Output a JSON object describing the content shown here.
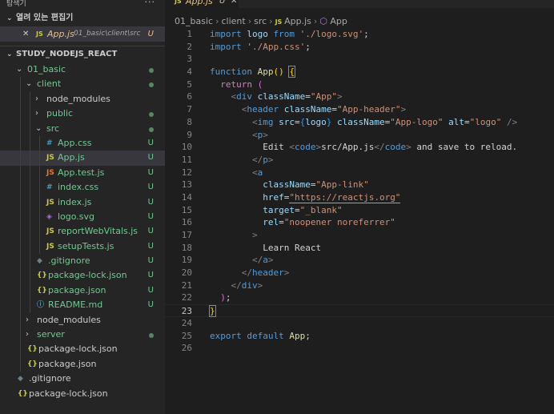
{
  "explorer": {
    "title": "탐색기",
    "more": "···",
    "open_editors_label": "열려 있는 편집기",
    "open_editor": {
      "icon": "JS",
      "name": "App.js",
      "path": "01_basic\\client\\src",
      "status": "U",
      "close": "✕"
    },
    "project_label": "STUDY_NODEJS_REACT"
  },
  "tree": [
    {
      "label": "01_basic",
      "type": "folder",
      "open": true,
      "depth": 0,
      "status": "dot"
    },
    {
      "label": "client",
      "type": "folder",
      "open": true,
      "depth": 1,
      "status": "dot"
    },
    {
      "label": "node_modules",
      "type": "folder",
      "open": false,
      "depth": 2,
      "status": ""
    },
    {
      "label": "public",
      "type": "folder",
      "open": false,
      "depth": 2,
      "status": "dot"
    },
    {
      "label": "src",
      "type": "folder",
      "open": true,
      "depth": 2,
      "status": "dot"
    },
    {
      "label": "App.css",
      "icon": "#",
      "icon_class": "ic-css",
      "depth": 3,
      "status": "U"
    },
    {
      "label": "App.js",
      "icon": "JS",
      "icon_class": "ic-js",
      "depth": 3,
      "status": "U",
      "selected": true
    },
    {
      "label": "App.test.js",
      "icon": "JS",
      "icon_class": "ic-jsx",
      "depth": 3,
      "status": "U"
    },
    {
      "label": "index.css",
      "icon": "#",
      "icon_class": "ic-css",
      "depth": 3,
      "status": "U"
    },
    {
      "label": "index.js",
      "icon": "JS",
      "icon_class": "ic-js",
      "depth": 3,
      "status": "U"
    },
    {
      "label": "logo.svg",
      "icon": "◈",
      "icon_class": "ic-svg",
      "depth": 3,
      "status": "U"
    },
    {
      "label": "reportWebVitals.js",
      "icon": "JS",
      "icon_class": "ic-js",
      "depth": 3,
      "status": "U"
    },
    {
      "label": "setupTests.js",
      "icon": "JS",
      "icon_class": "ic-js",
      "depth": 3,
      "status": "U"
    },
    {
      "label": ".gitignore",
      "icon": "◆",
      "icon_class": "ic-git",
      "depth": 2,
      "status": "U"
    },
    {
      "label": "package-lock.json",
      "icon": "{}",
      "icon_class": "ic-json",
      "depth": 2,
      "status": "U"
    },
    {
      "label": "package.json",
      "icon": "{}",
      "icon_class": "ic-json",
      "depth": 2,
      "status": "U"
    },
    {
      "label": "README.md",
      "icon": "ⓘ",
      "icon_class": "ic-md",
      "depth": 2,
      "status": "U"
    },
    {
      "label": "node_modules",
      "type": "folder",
      "open": false,
      "depth": 1,
      "status": ""
    },
    {
      "label": "server",
      "type": "folder",
      "open": false,
      "depth": 1,
      "status": "dot"
    },
    {
      "label": "package-lock.json",
      "icon": "{}",
      "icon_class": "ic-json",
      "depth": 1,
      "status": "",
      "plain": true
    },
    {
      "label": "package.json",
      "icon": "{}",
      "icon_class": "ic-json",
      "depth": 1,
      "status": "",
      "plain": true
    },
    {
      "label": ".gitignore",
      "icon": "◆",
      "icon_class": "ic-git",
      "depth": 0,
      "status": "",
      "plain": true
    },
    {
      "label": "package-lock.json",
      "icon": "{}",
      "icon_class": "ic-json",
      "depth": 0,
      "status": "",
      "plain": true
    }
  ],
  "tab": {
    "icon": "JS",
    "name": "App.js",
    "status": "U",
    "close": "✕"
  },
  "breadcrumb": [
    "01_basic",
    "client",
    "src",
    "App.js",
    "App"
  ],
  "current_line": 23,
  "code": [
    [
      [
        "kw",
        "import"
      ],
      [
        "pl",
        " "
      ],
      [
        "var",
        "logo"
      ],
      [
        "pl",
        " "
      ],
      [
        "kw",
        "from"
      ],
      [
        "pl",
        " "
      ],
      [
        "str",
        "'./logo.svg'"
      ],
      [
        "pl",
        ";"
      ]
    ],
    [
      [
        "kw",
        "import"
      ],
      [
        "pl",
        " "
      ],
      [
        "str",
        "'./App.css'"
      ],
      [
        "pl",
        ";"
      ]
    ],
    [],
    [
      [
        "kw",
        "function"
      ],
      [
        "pl",
        " "
      ],
      [
        "fnc",
        "App"
      ],
      [
        "brc1",
        "()"
      ],
      [
        "pl",
        " "
      ],
      [
        "brc1",
        "{"
      ]
    ],
    [
      [
        "pl",
        "  "
      ],
      [
        "ctl",
        "return"
      ],
      [
        "pl",
        " "
      ],
      [
        "brc2",
        "("
      ]
    ],
    [
      [
        "pl",
        "    "
      ],
      [
        "brk",
        "<"
      ],
      [
        "tag",
        "div"
      ],
      [
        "pl",
        " "
      ],
      [
        "att",
        "className"
      ],
      [
        "pl",
        "="
      ],
      [
        "str",
        "\"App\""
      ],
      [
        "brk",
        ">"
      ]
    ],
    [
      [
        "pl",
        "      "
      ],
      [
        "brk",
        "<"
      ],
      [
        "tag",
        "header"
      ],
      [
        "pl",
        " "
      ],
      [
        "att",
        "className"
      ],
      [
        "pl",
        "="
      ],
      [
        "str",
        "\"App-header\""
      ],
      [
        "brk",
        ">"
      ]
    ],
    [
      [
        "pl",
        "        "
      ],
      [
        "brk",
        "<"
      ],
      [
        "tag",
        "img"
      ],
      [
        "pl",
        " "
      ],
      [
        "att",
        "src"
      ],
      [
        "pl",
        "="
      ],
      [
        "brc3",
        "{"
      ],
      [
        "var",
        "logo"
      ],
      [
        "brc3",
        "}"
      ],
      [
        "pl",
        " "
      ],
      [
        "att",
        "className"
      ],
      [
        "pl",
        "="
      ],
      [
        "str",
        "\"App-logo\""
      ],
      [
        "pl",
        " "
      ],
      [
        "att",
        "alt"
      ],
      [
        "pl",
        "="
      ],
      [
        "str",
        "\"logo\""
      ],
      [
        "pl",
        " "
      ],
      [
        "brk",
        "/>"
      ]
    ],
    [
      [
        "pl",
        "        "
      ],
      [
        "brk",
        "<"
      ],
      [
        "tag",
        "p"
      ],
      [
        "brk",
        ">"
      ]
    ],
    [
      [
        "pl",
        "          Edit "
      ],
      [
        "brk",
        "<"
      ],
      [
        "tag",
        "code"
      ],
      [
        "brk",
        ">"
      ],
      [
        "pl",
        "src/App.js"
      ],
      [
        "brk",
        "</"
      ],
      [
        "tag",
        "code"
      ],
      [
        "brk",
        ">"
      ],
      [
        "pl",
        " and save to reload."
      ]
    ],
    [
      [
        "pl",
        "        "
      ],
      [
        "brk",
        "</"
      ],
      [
        "tag",
        "p"
      ],
      [
        "brk",
        ">"
      ]
    ],
    [
      [
        "pl",
        "        "
      ],
      [
        "brk",
        "<"
      ],
      [
        "tag",
        "a"
      ]
    ],
    [
      [
        "pl",
        "          "
      ],
      [
        "att",
        "className"
      ],
      [
        "pl",
        "="
      ],
      [
        "str",
        "\"App-link\""
      ]
    ],
    [
      [
        "pl",
        "          "
      ],
      [
        "att",
        "href"
      ],
      [
        "pl",
        "="
      ],
      [
        "str",
        "\"https://reactjs.org\""
      ]
    ],
    [
      [
        "pl",
        "          "
      ],
      [
        "att",
        "target"
      ],
      [
        "pl",
        "="
      ],
      [
        "str",
        "\"_blank\""
      ]
    ],
    [
      [
        "pl",
        "          "
      ],
      [
        "att",
        "rel"
      ],
      [
        "pl",
        "="
      ],
      [
        "str",
        "\"noopener noreferrer\""
      ]
    ],
    [
      [
        "pl",
        "        "
      ],
      [
        "brk",
        ">"
      ]
    ],
    [
      [
        "pl",
        "          Learn React"
      ]
    ],
    [
      [
        "pl",
        "        "
      ],
      [
        "brk",
        "</"
      ],
      [
        "tag",
        "a"
      ],
      [
        "brk",
        ">"
      ]
    ],
    [
      [
        "pl",
        "      "
      ],
      [
        "brk",
        "</"
      ],
      [
        "tag",
        "header"
      ],
      [
        "brk",
        ">"
      ]
    ],
    [
      [
        "pl",
        "    "
      ],
      [
        "brk",
        "</"
      ],
      [
        "tag",
        "div"
      ],
      [
        "brk",
        ">"
      ]
    ],
    [
      [
        "pl",
        "  "
      ],
      [
        "brc2",
        ")"
      ],
      [
        "pl",
        ";"
      ]
    ],
    [
      [
        "brc1",
        "}"
      ]
    ],
    [],
    [
      [
        "kw",
        "export"
      ],
      [
        "pl",
        " "
      ],
      [
        "kw",
        "default"
      ],
      [
        "pl",
        " "
      ],
      [
        "fnc",
        "App"
      ],
      [
        "pl",
        ";"
      ]
    ],
    []
  ]
}
